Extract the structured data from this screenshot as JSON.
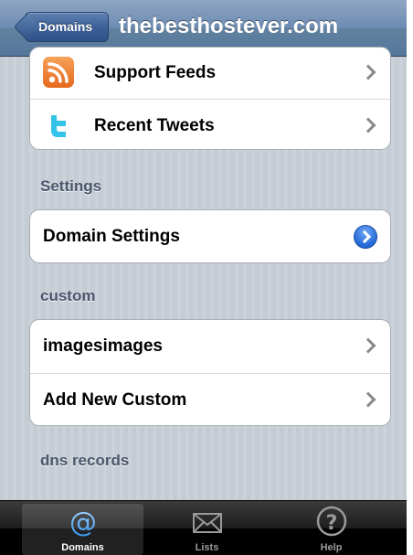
{
  "navbar": {
    "back_label": "Domains",
    "title": "thebesthostever.com"
  },
  "groups": {
    "feeds": [
      {
        "label": "Support Feeds",
        "icon": "rss-icon"
      },
      {
        "label": "Recent Tweets",
        "icon": "tweet-icon"
      }
    ],
    "settings_header": "Settings",
    "settings": [
      {
        "label": "Domain Settings",
        "icon": "disclosure-icon"
      }
    ],
    "custom_header": "custom",
    "custom": [
      {
        "label": "imagesimages"
      },
      {
        "label": "Add New Custom"
      }
    ],
    "dns_header": "dns records"
  },
  "tabbar": {
    "tabs": [
      {
        "label": "Domains",
        "icon": "at-icon",
        "selected": true
      },
      {
        "label": "Lists",
        "icon": "envelope-icon",
        "selected": false
      },
      {
        "label": "Help",
        "icon": "help-icon",
        "selected": false
      }
    ]
  },
  "colors": {
    "navbar": "#6e8db3",
    "background": "#c5ccd4",
    "section_header": "#4c566c",
    "disclosure_blue": "#2468d8",
    "rss_orange": "#e5691e",
    "tweet_cyan": "#33c2e8"
  }
}
